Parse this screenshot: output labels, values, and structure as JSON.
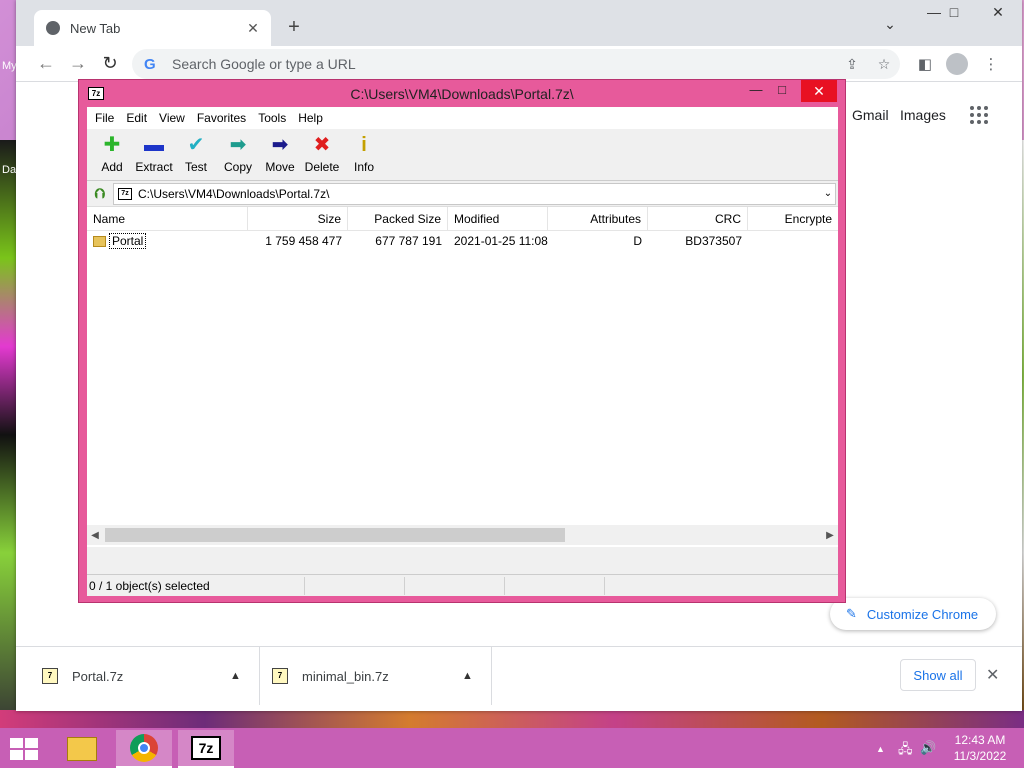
{
  "desktop": {
    "label_top": "My",
    "label_mid": "Da"
  },
  "browser": {
    "tab": {
      "title": "New Tab",
      "close": "✕"
    },
    "new_tab": "+",
    "window_controls": {
      "list": "⌄",
      "minimize": "—",
      "maximize": "□",
      "close": "✕"
    },
    "toolbar": {
      "back": "←",
      "forward": "→",
      "reload": "↻",
      "omnibox_placeholder": "Search Google or type a URL",
      "omnibox_g": "G"
    },
    "page": {
      "gmail": "Gmail",
      "images": "Images",
      "customize": "Customize Chrome"
    },
    "downloads": {
      "items": [
        {
          "name": "Portal.7z"
        },
        {
          "name": "minimal_bin.7z"
        }
      ],
      "show_all": "Show all",
      "close": "✕"
    }
  },
  "sevenzip": {
    "title": "C:\\Users\\VM4\\Downloads\\Portal.7z\\",
    "menu": [
      "File",
      "Edit",
      "View",
      "Favorites",
      "Tools",
      "Help"
    ],
    "toolbar": [
      {
        "label": "Add",
        "icon": "add-icon",
        "glyph": "✚",
        "color": "#2bb52b"
      },
      {
        "label": "Extract",
        "icon": "extract-icon",
        "glyph": "▬",
        "color": "#1d35c9"
      },
      {
        "label": "Test",
        "icon": "test-icon",
        "glyph": "✔",
        "color": "#22b0c4"
      },
      {
        "label": "Copy",
        "icon": "copy-icon",
        "glyph": "➡",
        "color": "#1e9c8e"
      },
      {
        "label": "Move",
        "icon": "move-icon",
        "glyph": "➡",
        "color": "#1b1b8c"
      },
      {
        "label": "Delete",
        "icon": "delete-icon",
        "glyph": "✖",
        "color": "#e01e1e"
      },
      {
        "label": "Info",
        "icon": "info-icon",
        "glyph": "i",
        "color": "#c4a000"
      }
    ],
    "address": "C:\\Users\\VM4\\Downloads\\Portal.7z\\",
    "columns": {
      "name": "Name",
      "size": "Size",
      "packed": "Packed Size",
      "modified": "Modified",
      "attributes": "Attributes",
      "crc": "CRC",
      "encrypted": "Encrypte"
    },
    "rows": [
      {
        "name": "Portal",
        "size": "1 759 458 477",
        "packed": "677 787 191",
        "modified": "2021-01-25 11:08",
        "attributes": "D",
        "crc": "BD373507",
        "encrypted": ""
      }
    ],
    "status": "0 / 1 object(s) selected"
  },
  "taskbar": {
    "zip_label": "7z",
    "clock_time": "12:43 AM",
    "clock_date": "11/3/2022"
  }
}
